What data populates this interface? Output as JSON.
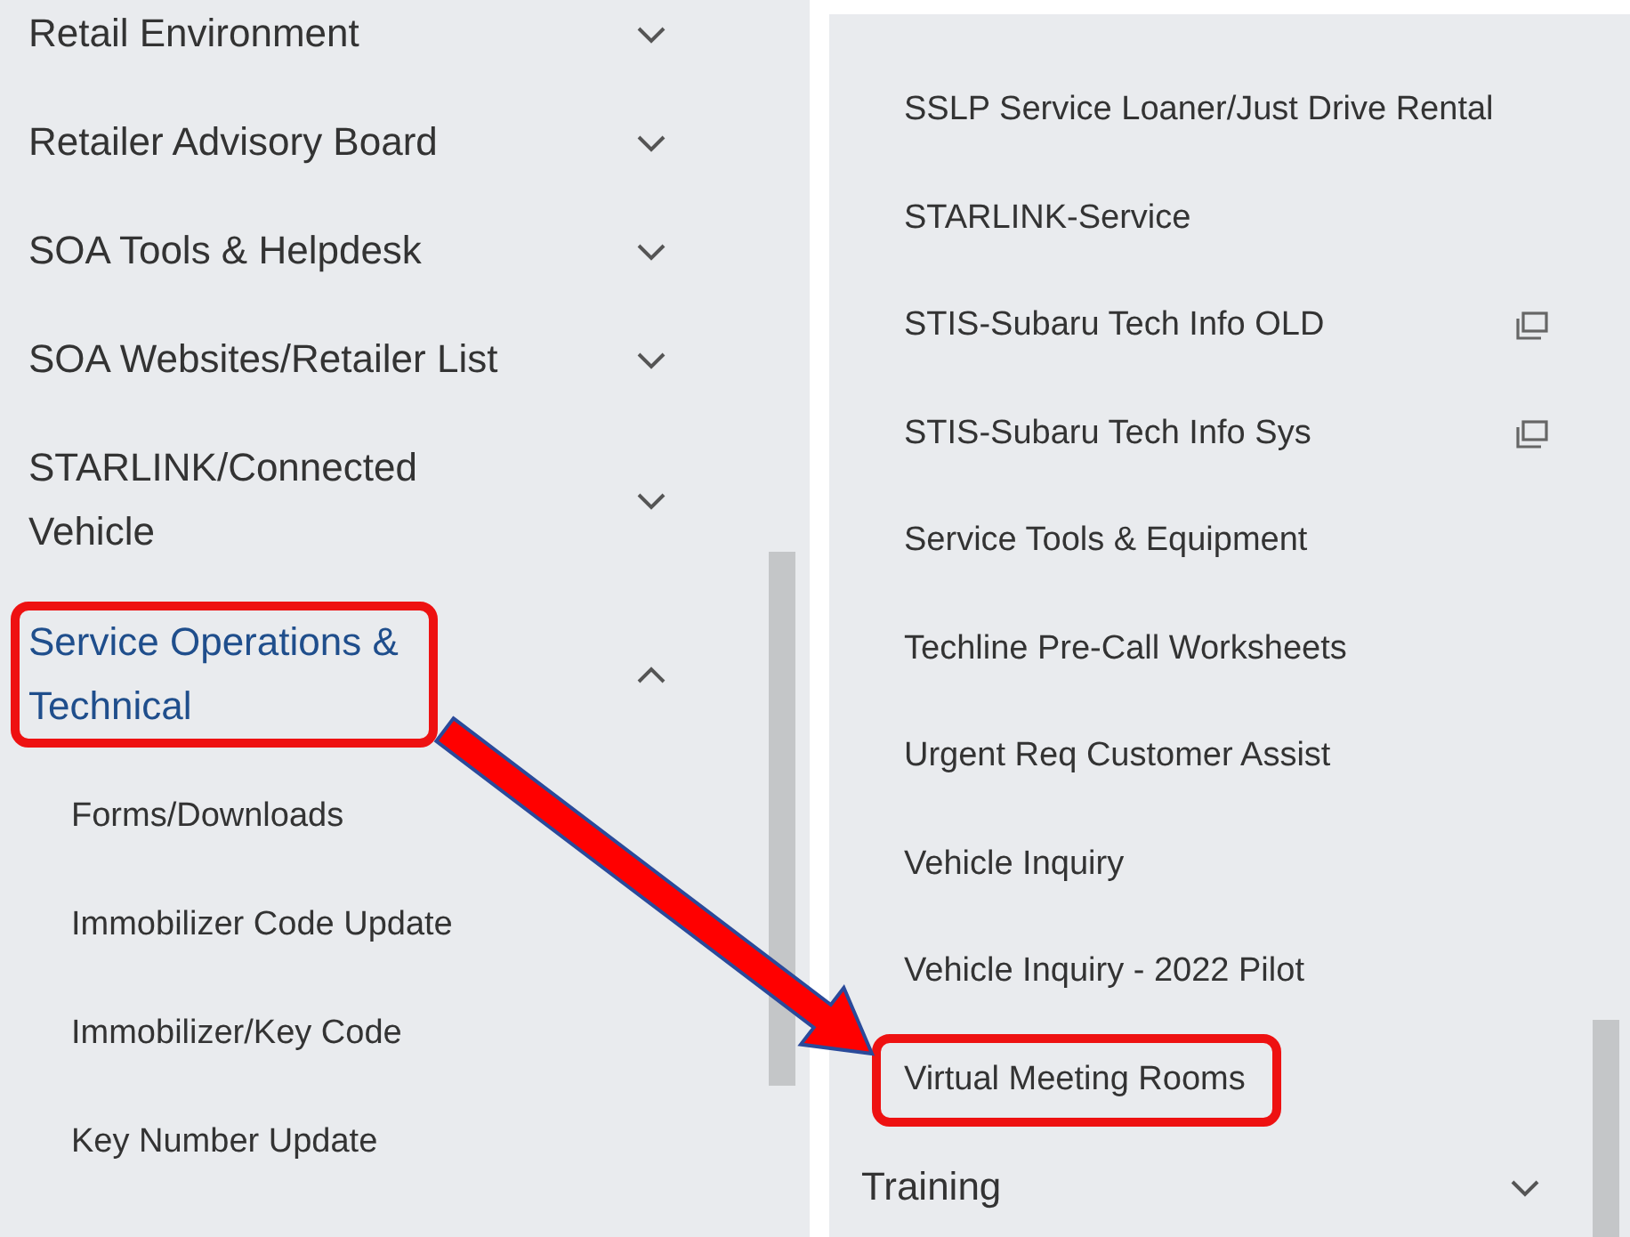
{
  "left_panel": {
    "items": [
      {
        "label": "Retail Environment",
        "expanded": false,
        "selected": false,
        "highlighted": false
      },
      {
        "label": "Retailer Advisory Board",
        "expanded": false,
        "selected": false,
        "highlighted": false
      },
      {
        "label": "SOA Tools & Helpdesk",
        "expanded": false,
        "selected": false,
        "highlighted": false
      },
      {
        "label": "SOA Websites/Retailer List",
        "expanded": false,
        "selected": false,
        "highlighted": false
      },
      {
        "label": "STARLINK/Connected Vehicle",
        "expanded": false,
        "selected": false,
        "highlighted": false
      },
      {
        "label": "Service Operations & Technical",
        "expanded": true,
        "selected": true,
        "highlighted": true,
        "children": [
          {
            "label": "Forms/Downloads"
          },
          {
            "label": "Immobilizer Code Update"
          },
          {
            "label": "Immobilizer/Key Code"
          },
          {
            "label": "Key Number Update"
          }
        ]
      }
    ]
  },
  "right_panel": {
    "items": [
      {
        "kind": "link",
        "label": "SSLP Service Loaner/Just Drive Rental",
        "external": false,
        "highlighted": false
      },
      {
        "kind": "link",
        "label": "STARLINK-Service",
        "external": false,
        "highlighted": false
      },
      {
        "kind": "link",
        "label": "STIS-Subaru Tech Info OLD",
        "external": true,
        "highlighted": false
      },
      {
        "kind": "link",
        "label": "STIS-Subaru Tech Info Sys",
        "external": true,
        "highlighted": false
      },
      {
        "kind": "link",
        "label": "Service Tools & Equipment",
        "external": false,
        "highlighted": false
      },
      {
        "kind": "link",
        "label": "Techline Pre-Call Worksheets",
        "external": false,
        "highlighted": false
      },
      {
        "kind": "link",
        "label": "Urgent Req Customer Assist",
        "external": false,
        "highlighted": false
      },
      {
        "kind": "link",
        "label": "Vehicle Inquiry",
        "external": false,
        "highlighted": false
      },
      {
        "kind": "link",
        "label": "Vehicle Inquiry - 2022 Pilot",
        "external": false,
        "highlighted": false
      },
      {
        "kind": "link",
        "label": "Virtual Meeting Rooms",
        "external": false,
        "highlighted": true
      },
      {
        "kind": "section",
        "label": "Training",
        "expanded": false
      }
    ]
  }
}
